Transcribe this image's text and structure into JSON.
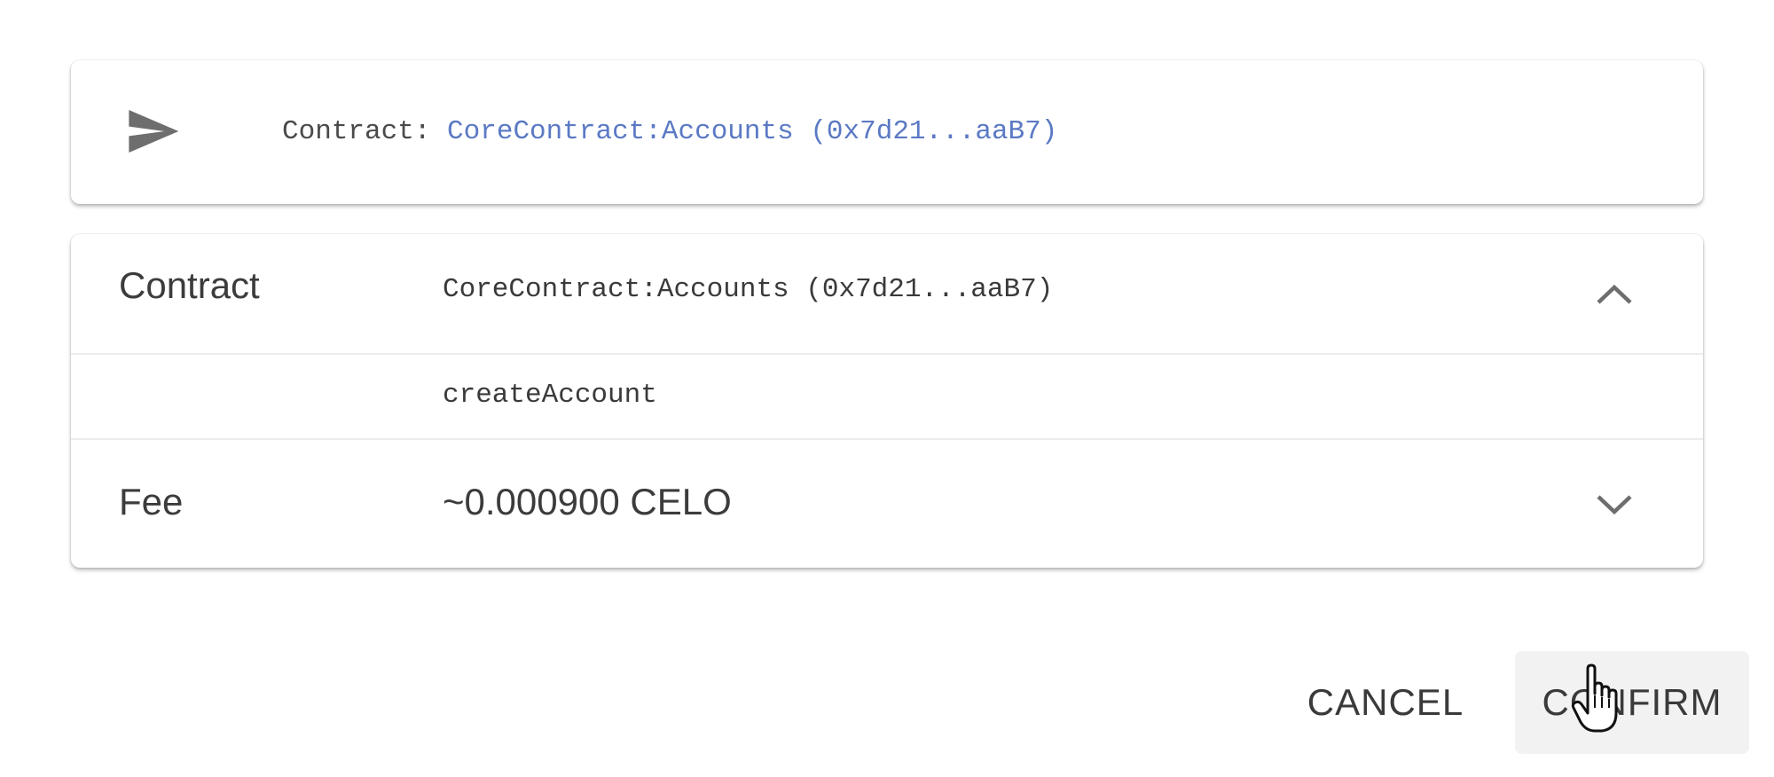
{
  "transaction": {
    "icon": "send-icon",
    "prefix": "Contract:",
    "contract_link": "CoreContract:Accounts (0x7d21...aaB7)"
  },
  "details": {
    "contract": {
      "label": "Contract",
      "value": "CoreContract:Accounts (0x7d21...aaB7)",
      "expand_icon": "chevron-up-icon"
    },
    "method": {
      "value": "createAccount"
    },
    "fee": {
      "label": "Fee",
      "value": "~0.000900 CELO",
      "expand_icon": "chevron-down-icon"
    }
  },
  "actions": {
    "cancel_label": "CANCEL",
    "confirm_label": "CONFIRM"
  },
  "colors": {
    "link": "#5b79c4",
    "text": "#3a3a3a",
    "icon": "#6e6e6e",
    "divider": "#ececec",
    "confirm_hover_bg": "#f2f2f2"
  }
}
